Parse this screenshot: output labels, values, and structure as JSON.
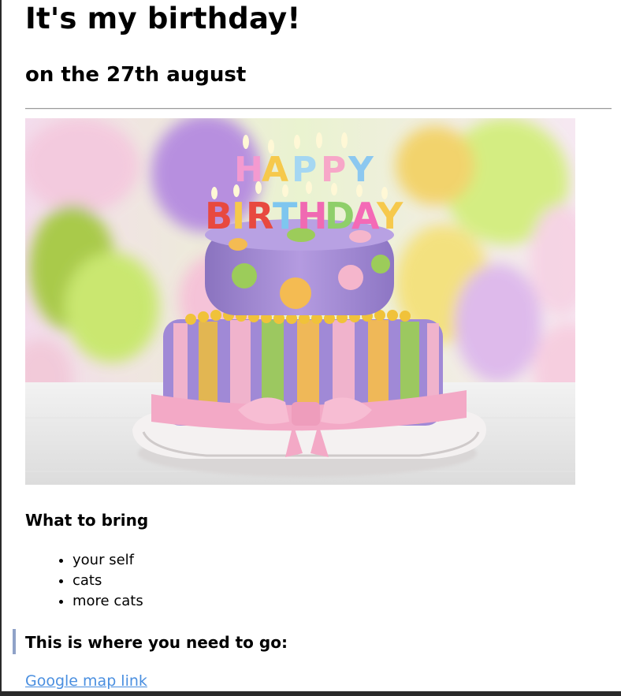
{
  "page": {
    "title": "It's my birthday!",
    "subtitle": "on the 27th august"
  },
  "hero_image": {
    "description": "",
    "cake_lettering": [
      "HAPPY",
      "BIRTHDAY"
    ]
  },
  "bring": {
    "heading": "What to bring",
    "items": [
      "your self",
      "cats",
      "more cats"
    ]
  },
  "directions": {
    "heading": "This is where you need to go:",
    "link_label": "Google map link"
  },
  "colors": {
    "link": "#4a8fe0",
    "quote_bar": "#8fa2c8",
    "rule": "#9a9a9a"
  }
}
